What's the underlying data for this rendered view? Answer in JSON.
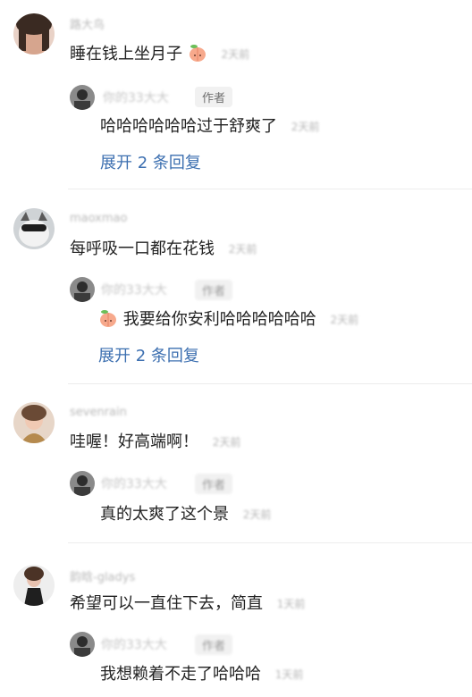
{
  "comments": [
    {
      "username": "路大鸟",
      "text": "睡在钱上坐月子",
      "time": "2天前",
      "reply": {
        "username": "你的33大大",
        "badge": "作者",
        "text": "哈哈哈哈哈哈过于舒爽了",
        "time": "2天前"
      },
      "expand": "展开 2 条回复"
    },
    {
      "username": "maoxmao",
      "text": "每呼吸一口都在花钱",
      "time": "2天前",
      "reply": {
        "username": "你的33大大",
        "badge": "作者",
        "text": "我要给你安利哈哈哈哈哈哈",
        "time": "2天前"
      },
      "expand": "展开 2 条回复"
    },
    {
      "username": "sevenrain",
      "text": "哇喔！好高端啊！",
      "time": "2天前",
      "reply": {
        "username": "你的33大大",
        "badge": "作者",
        "text": "真的太爽了这个景",
        "time": "2天前"
      }
    },
    {
      "username": "韵晗-gladys",
      "text": "希望可以一直住下去，简直",
      "time": "1天前",
      "reply": {
        "username": "你的33大大",
        "badge": "作者",
        "text": "我想赖着不走了哈哈哈",
        "time": "1天前"
      }
    }
  ]
}
